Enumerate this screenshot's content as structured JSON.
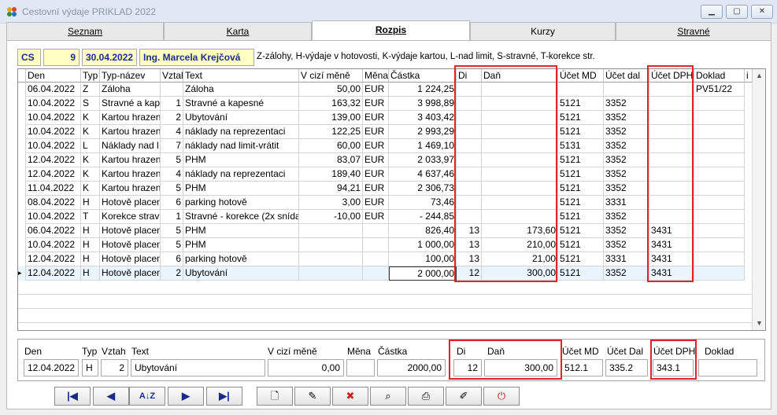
{
  "window": {
    "title": "Cestovní výdaje PRIKLAD 2022"
  },
  "tabs": [
    {
      "label": "Seznam"
    },
    {
      "label": "Karta"
    },
    {
      "label": "Rozpis"
    },
    {
      "label": "Kurzy"
    },
    {
      "label": "Stravné"
    }
  ],
  "info": {
    "code": "CS",
    "number": "9",
    "date": "30.04.2022",
    "person": "Ing. Marcela Krejčová",
    "legend": "Z-zálohy, H-výdaje v hotovosti, K-výdaje kartou, L-nad limit, S-stravné, T-korekce str."
  },
  "grid": {
    "columns": [
      "Den",
      "Typ",
      "Typ-název",
      "Vztah",
      "Text",
      "V cizí měně",
      "Měna",
      "Částka",
      "Di",
      "Daň",
      "Účet MD",
      "Účet dal",
      "Účet DPH",
      "Doklad",
      "i"
    ],
    "rows": [
      {
        "den": "06.04.2022",
        "typ": "Z",
        "nazev": "Záloha",
        "vztah": "",
        "text": "Záloha",
        "cizi": "50,00",
        "mena": "EUR",
        "castka": "1 224,25",
        "di": "",
        "dan": "",
        "md": "",
        "dal": "",
        "dph": "",
        "doklad": "PV51/22"
      },
      {
        "den": "10.04.2022",
        "typ": "S",
        "nazev": "Stravné a kap",
        "vztah": "1",
        "text": "Stravné a kapesné",
        "cizi": "163,32",
        "mena": "EUR",
        "castka": "3 998,89",
        "di": "",
        "dan": "",
        "md": "5121",
        "dal": "3352",
        "dph": "",
        "doklad": ""
      },
      {
        "den": "10.04.2022",
        "typ": "K",
        "nazev": "Kartou hrazen",
        "vztah": "2",
        "text": "Ubytování",
        "cizi": "139,00",
        "mena": "EUR",
        "castka": "3 403,42",
        "di": "",
        "dan": "",
        "md": "5121",
        "dal": "3352",
        "dph": "",
        "doklad": ""
      },
      {
        "den": "10.04.2022",
        "typ": "K",
        "nazev": "Kartou hrazen",
        "vztah": "4",
        "text": "náklady na reprezentaci",
        "cizi": "122,25",
        "mena": "EUR",
        "castka": "2 993,29",
        "di": "",
        "dan": "",
        "md": "5121",
        "dal": "3352",
        "dph": "",
        "doklad": ""
      },
      {
        "den": "10.04.2022",
        "typ": "L",
        "nazev": "Náklady nad l",
        "vztah": "7",
        "text": "náklady nad limit-vrátit",
        "cizi": "60,00",
        "mena": "EUR",
        "castka": "1 469,10",
        "di": "",
        "dan": "",
        "md": "5131",
        "dal": "3352",
        "dph": "",
        "doklad": ""
      },
      {
        "den": "12.04.2022",
        "typ": "K",
        "nazev": "Kartou hrazen",
        "vztah": "5",
        "text": "PHM",
        "cizi": "83,07",
        "mena": "EUR",
        "castka": "2 033,97",
        "di": "",
        "dan": "",
        "md": "5121",
        "dal": "3352",
        "dph": "",
        "doklad": ""
      },
      {
        "den": "12.04.2022",
        "typ": "K",
        "nazev": "Kartou hrazen",
        "vztah": "4",
        "text": "náklady na reprezentaci",
        "cizi": "189,40",
        "mena": "EUR",
        "castka": "4 637,46",
        "di": "",
        "dan": "",
        "md": "5121",
        "dal": "3352",
        "dph": "",
        "doklad": ""
      },
      {
        "den": "11.04.2022",
        "typ": "K",
        "nazev": "Kartou hrazen",
        "vztah": "5",
        "text": "PHM",
        "cizi": "94,21",
        "mena": "EUR",
        "castka": "2 306,73",
        "di": "",
        "dan": "",
        "md": "5121",
        "dal": "3352",
        "dph": "",
        "doklad": ""
      },
      {
        "den": "08.04.2022",
        "typ": "H",
        "nazev": "Hotově placen",
        "vztah": "6",
        "text": "parking hotově",
        "cizi": "3,00",
        "mena": "EUR",
        "castka": "73,46",
        "di": "",
        "dan": "",
        "md": "5121",
        "dal": "3331",
        "dph": "",
        "doklad": ""
      },
      {
        "den": "10.04.2022",
        "typ": "T",
        "nazev": "Korekce strav",
        "vztah": "1",
        "text": "Stravné - korekce (2x snída",
        "cizi": "-10,00",
        "mena": "EUR",
        "castka": "- 244,85",
        "di": "",
        "dan": "",
        "md": "5121",
        "dal": "3352",
        "dph": "",
        "doklad": ""
      },
      {
        "den": "06.04.2022",
        "typ": "H",
        "nazev": "Hotově placen",
        "vztah": "5",
        "text": "PHM",
        "cizi": "",
        "mena": "",
        "castka": "826,40",
        "di": "13",
        "dan": "173,60",
        "md": "5121",
        "dal": "3352",
        "dph": "3431",
        "doklad": ""
      },
      {
        "den": "10.04.2022",
        "typ": "H",
        "nazev": "Hotově placen",
        "vztah": "5",
        "text": "PHM",
        "cizi": "",
        "mena": "",
        "castka": "1 000,00",
        "di": "13",
        "dan": "210,00",
        "md": "5121",
        "dal": "3352",
        "dph": "3431",
        "doklad": ""
      },
      {
        "den": "12.04.2022",
        "typ": "H",
        "nazev": "Hotově placen",
        "vztah": "6",
        "text": "parking hotově",
        "cizi": "",
        "mena": "",
        "castka": "100,00",
        "di": "13",
        "dan": "21,00",
        "md": "5121",
        "dal": "3331",
        "dph": "3431",
        "doklad": ""
      },
      {
        "den": "12.04.2022",
        "typ": "H",
        "nazev": "Hotově placen",
        "vztah": "2",
        "text": "Ubytování",
        "cizi": "",
        "mena": "",
        "castka": "2 000,00",
        "di": "12",
        "dan": "300,00",
        "md": "5121",
        "dal": "3352",
        "dph": "3431",
        "doklad": ""
      }
    ]
  },
  "detail": {
    "labels": {
      "den": "Den",
      "typ": "Typ",
      "vztah": "Vztah",
      "text": "Text",
      "cizi": "V cizí měně",
      "mena": "Měna",
      "castka": "Částka",
      "di": "Di",
      "dan": "Daň",
      "md": "Účet MD",
      "dal": "Účet Dal",
      "dph": "Účet DPH",
      "doklad": "Doklad"
    },
    "values": {
      "den": "12.04.2022",
      "typ": "H",
      "vztah": "2",
      "text": "Ubytování",
      "cizi": "0,00",
      "mena": "",
      "castka": "2000,00",
      "di": "12",
      "dan": "300,00",
      "md": "512.1",
      "dal": "335.2",
      "dph": "343.1",
      "doklad": ""
    }
  },
  "toolbar": {
    "buttons": [
      "first-icon",
      "prev-icon",
      "sort-icon",
      "next-icon",
      "last-icon",
      "new-doc-icon",
      "edit-icon",
      "delete-icon",
      "find-icon",
      "print-icon",
      "clear-icon",
      "power-icon"
    ]
  },
  "colors": {
    "highlight": "#e0242c",
    "info_bg": "#ffffc4",
    "info_text": "#1c2e8c"
  }
}
